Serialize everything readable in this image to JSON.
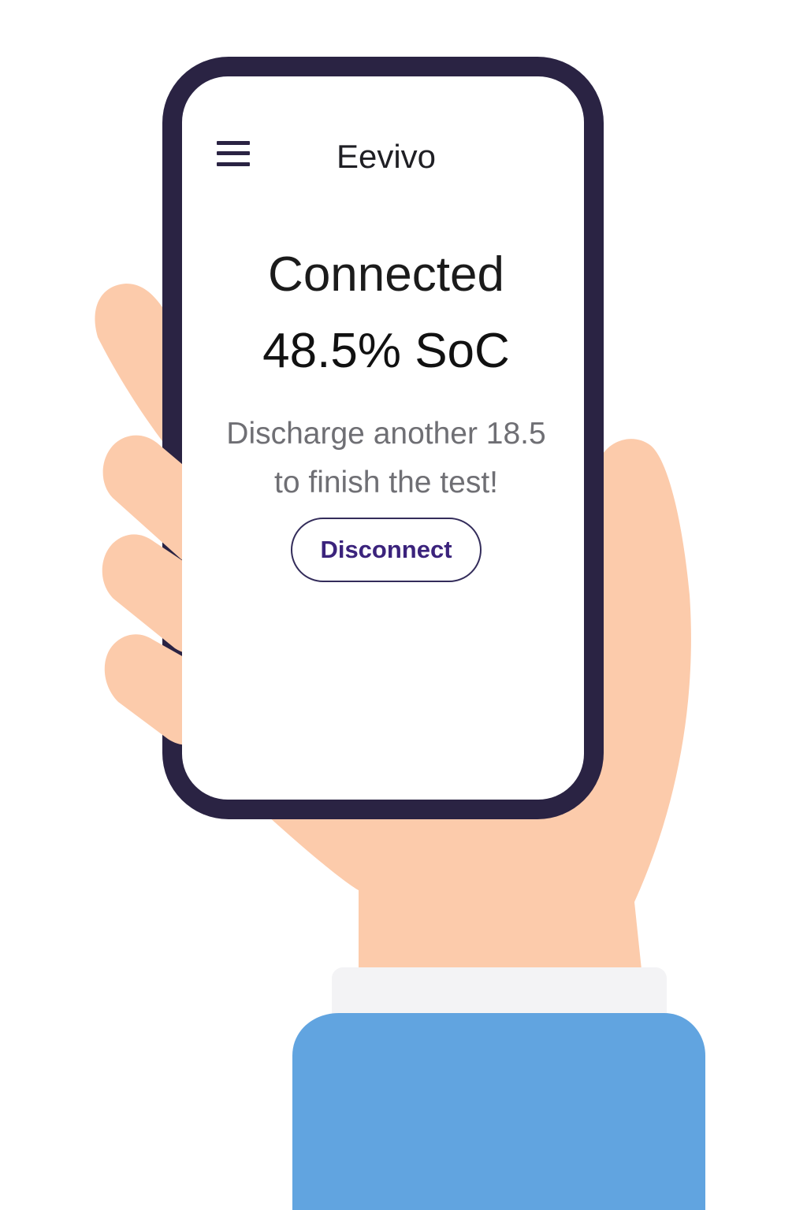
{
  "header": {
    "menu_icon": "hamburger-menu-icon",
    "title": "Eevivo"
  },
  "main": {
    "status": "Connected",
    "state_of_charge": "48.5% SoC",
    "instruction_line_1": "Discharge another 18.5",
    "instruction_line_2": "to finish the test!",
    "disconnect_label": "Disconnect"
  },
  "colors": {
    "phone_frame": "#2a2343",
    "skin": "#fccbab",
    "sleeve": "#61a4e0",
    "cuff": "#f3f3f5",
    "button_text": "#3b237c"
  }
}
